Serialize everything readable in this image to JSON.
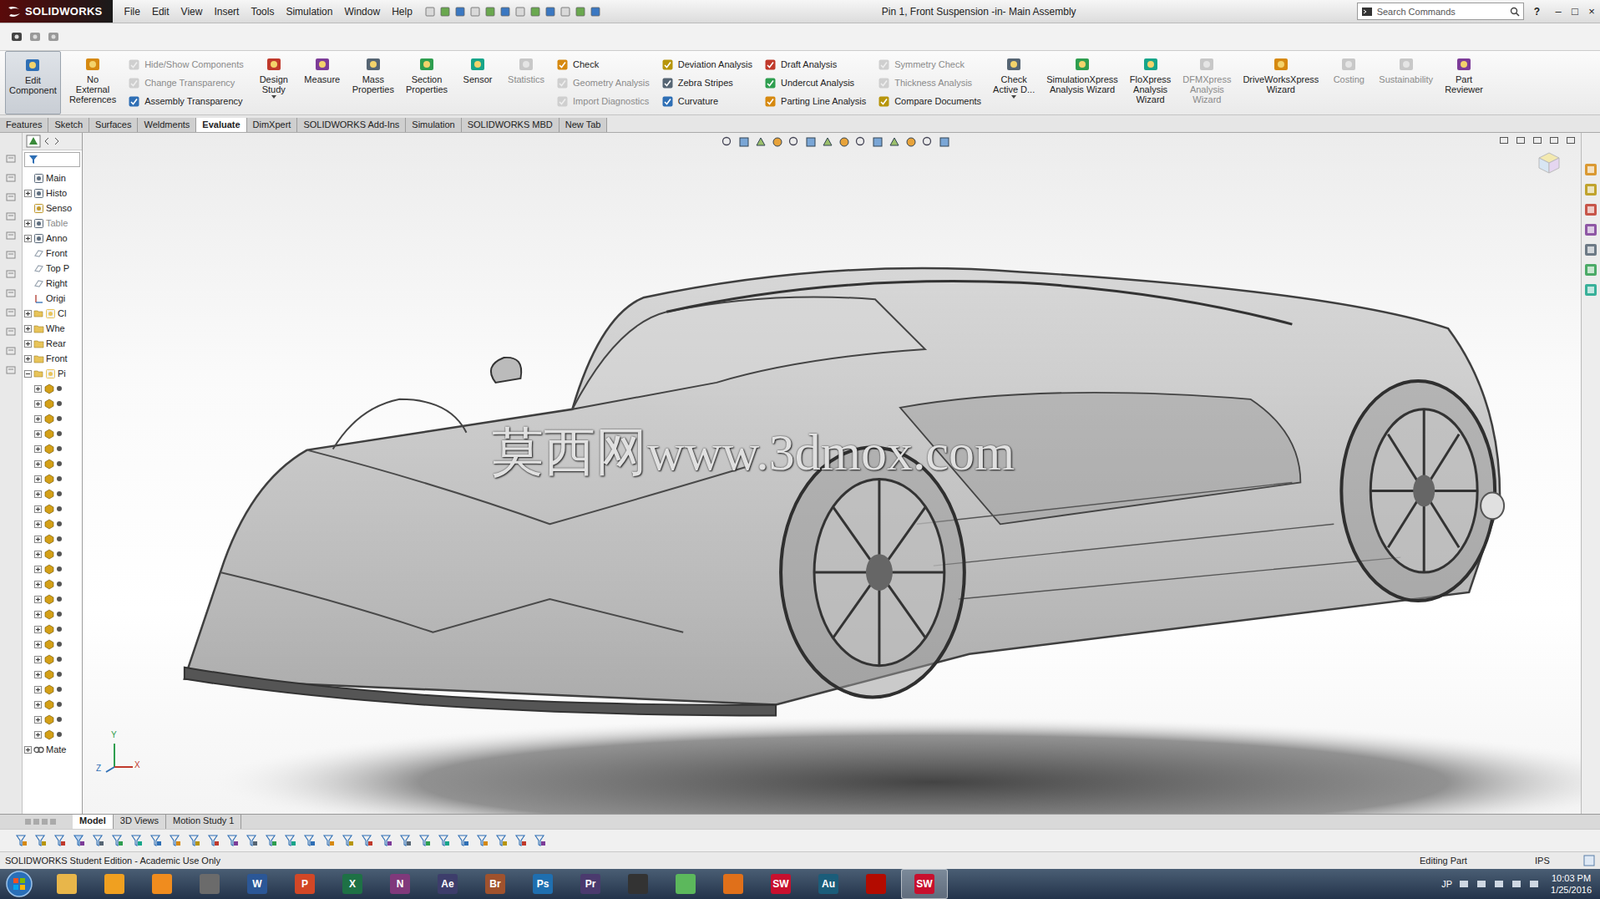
{
  "window": {
    "title": "Pin 1, Front Suspension -in- Main Assembly",
    "help": "?",
    "controls": [
      "–",
      "□",
      "×"
    ]
  },
  "logo": {
    "name": "SOLIDWORKS"
  },
  "menu": [
    "File",
    "Edit",
    "View",
    "Insert",
    "Tools",
    "Simulation",
    "Window",
    "Help"
  ],
  "search": {
    "placeholder": "Search Commands"
  },
  "ribbon": [
    {
      "kind": "large",
      "lines": [
        "Edit",
        "Component"
      ],
      "disabled": false,
      "selected": true,
      "dropdown": false
    },
    {
      "kind": "large",
      "lines": [
        "No",
        "External",
        "References"
      ],
      "disabled": false,
      "selected": false,
      "dropdown": false
    },
    {
      "kind": "stack",
      "items": [
        {
          "label": "Hide/Show Components",
          "disabled": true
        },
        {
          "label": "Change Transparency",
          "disabled": true
        },
        {
          "label": "Assembly Transparency",
          "disabled": false
        }
      ]
    },
    {
      "kind": "large",
      "lines": [
        "Design",
        "Study"
      ],
      "disabled": false,
      "selected": false,
      "dropdown": true
    },
    {
      "kind": "large",
      "lines": [
        "Measure"
      ],
      "disabled": false,
      "selected": false,
      "dropdown": false
    },
    {
      "kind": "large",
      "lines": [
        "Mass",
        "Properties"
      ],
      "disabled": false,
      "selected": false,
      "dropdown": false
    },
    {
      "kind": "large",
      "lines": [
        "Section",
        "Properties"
      ],
      "disabled": false,
      "selected": false,
      "dropdown": false
    },
    {
      "kind": "large",
      "lines": [
        "Sensor"
      ],
      "disabled": false,
      "selected": false,
      "dropdown": false
    },
    {
      "kind": "large",
      "lines": [
        "Statistics"
      ],
      "disabled": true,
      "selected": false,
      "dropdown": false
    },
    {
      "kind": "stack",
      "items": [
        {
          "label": "Check",
          "disabled": false
        },
        {
          "label": "Geometry Analysis",
          "disabled": true
        },
        {
          "label": "Import Diagnostics",
          "disabled": true
        }
      ]
    },
    {
      "kind": "stack",
      "items": [
        {
          "label": "Deviation Analysis",
          "disabled": false
        },
        {
          "label": "Zebra Stripes",
          "disabled": false
        },
        {
          "label": "Curvature",
          "disabled": false
        }
      ]
    },
    {
      "kind": "stack",
      "items": [
        {
          "label": "Draft Analysis",
          "disabled": false
        },
        {
          "label": "Undercut Analysis",
          "disabled": false
        },
        {
          "label": "Parting Line Analysis",
          "disabled": false
        }
      ]
    },
    {
      "kind": "stack",
      "items": [
        {
          "label": "Symmetry Check",
          "disabled": true
        },
        {
          "label": "Thickness Analysis",
          "disabled": true
        },
        {
          "label": "Compare Documents",
          "disabled": false
        }
      ]
    },
    {
      "kind": "large",
      "lines": [
        "Check",
        "Active D..."
      ],
      "disabled": false,
      "selected": false,
      "dropdown": true
    },
    {
      "kind": "large",
      "lines": [
        "SimulationXpress",
        "Analysis Wizard"
      ],
      "disabled": false,
      "selected": false,
      "dropdown": false
    },
    {
      "kind": "large",
      "lines": [
        "FloXpress",
        "Analysis",
        "Wizard"
      ],
      "disabled": false,
      "selected": false,
      "dropdown": false
    },
    {
      "kind": "large",
      "lines": [
        "DFMXpress",
        "Analysis",
        "Wizard"
      ],
      "disabled": true,
      "selected": false,
      "dropdown": false
    },
    {
      "kind": "large",
      "lines": [
        "DriveWorksXpress",
        "Wizard"
      ],
      "disabled": false,
      "selected": false,
      "dropdown": false
    },
    {
      "kind": "large",
      "lines": [
        "Costing"
      ],
      "disabled": true,
      "selected": false,
      "dropdown": false
    },
    {
      "kind": "large",
      "lines": [
        "Sustainability"
      ],
      "disabled": true,
      "selected": false,
      "dropdown": false
    },
    {
      "kind": "large",
      "lines": [
        "Part",
        "Reviewer"
      ],
      "disabled": false,
      "selected": false,
      "dropdown": false
    }
  ],
  "tabs": [
    {
      "label": "Features",
      "selected": false
    },
    {
      "label": "Sketch",
      "selected": false
    },
    {
      "label": "Surfaces",
      "selected": false
    },
    {
      "label": "Weldments",
      "selected": false
    },
    {
      "label": "Evaluate",
      "selected": true
    },
    {
      "label": "DimXpert",
      "selected": false
    },
    {
      "label": "SOLIDWORKS Add-Ins",
      "selected": false
    },
    {
      "label": "Simulation",
      "selected": false
    },
    {
      "label": "SOLIDWORKS MBD",
      "selected": false
    },
    {
      "label": "New Tab",
      "selected": false
    }
  ],
  "tree": [
    {
      "label": "Main",
      "kind": "assembly",
      "level": 0,
      "expandable": false,
      "expanded": true,
      "disabled": false
    },
    {
      "label": "Histo",
      "kind": "history",
      "level": 0,
      "expandable": true,
      "expanded": false,
      "disabled": false
    },
    {
      "label": "Senso",
      "kind": "sensor",
      "level": 0,
      "expandable": false,
      "expanded": false,
      "disabled": false
    },
    {
      "label": "Table",
      "kind": "table",
      "level": 0,
      "expandable": true,
      "expanded": false,
      "disabled": true
    },
    {
      "label": "Anno",
      "kind": "annotation",
      "level": 0,
      "expandable": true,
      "expanded": false,
      "disabled": false
    },
    {
      "label": "Front",
      "kind": "plane",
      "level": 0,
      "expandable": false,
      "expanded": false,
      "disabled": false
    },
    {
      "label": "Top P",
      "kind": "plane",
      "level": 0,
      "expandable": false,
      "expanded": false,
      "disabled": false
    },
    {
      "label": "Right",
      "kind": "plane",
      "level": 0,
      "expandable": false,
      "expanded": false,
      "disabled": false
    },
    {
      "label": "Origi",
      "kind": "origin",
      "level": 0,
      "expandable": false,
      "expanded": false,
      "disabled": false
    },
    {
      "label": "Cl",
      "kind": "folder-assembly",
      "level": 0,
      "expandable": true,
      "expanded": false,
      "disabled": false
    },
    {
      "label": "Whe",
      "kind": "folder",
      "level": 0,
      "expandable": true,
      "expanded": false,
      "disabled": false
    },
    {
      "label": "Rear",
      "kind": "folder",
      "level": 0,
      "expandable": true,
      "expanded": false,
      "disabled": false
    },
    {
      "label": "Front",
      "kind": "folder",
      "level": 0,
      "expandable": true,
      "expanded": false,
      "disabled": false
    },
    {
      "label": "Pi",
      "kind": "folder-assembly",
      "level": 0,
      "expandable": true,
      "expanded": true,
      "disabled": false
    },
    {
      "label": "",
      "kind": "part",
      "level": 1,
      "expandable": true,
      "expanded": false,
      "disabled": false
    },
    {
      "label": "",
      "kind": "part",
      "level": 1,
      "expandable": true,
      "expanded": false,
      "disabled": false
    },
    {
      "label": "",
      "kind": "part",
      "level": 1,
      "expandable": true,
      "expanded": false,
      "disabled": false
    },
    {
      "label": "",
      "kind": "part",
      "level": 1,
      "expandable": true,
      "expanded": false,
      "disabled": false
    },
    {
      "label": "",
      "kind": "part",
      "level": 1,
      "expandable": true,
      "expanded": false,
      "disabled": false
    },
    {
      "label": "",
      "kind": "part",
      "level": 1,
      "expandable": true,
      "expanded": false,
      "disabled": false
    },
    {
      "label": "",
      "kind": "part",
      "level": 1,
      "expandable": true,
      "expanded": false,
      "disabled": false
    },
    {
      "label": "",
      "kind": "part",
      "level": 1,
      "expandable": true,
      "expanded": false,
      "disabled": false
    },
    {
      "label": "",
      "kind": "part",
      "level": 1,
      "expandable": true,
      "expanded": false,
      "disabled": false
    },
    {
      "label": "",
      "kind": "part",
      "level": 1,
      "expandable": true,
      "expanded": false,
      "disabled": false
    },
    {
      "label": "",
      "kind": "part",
      "level": 1,
      "expandable": true,
      "expanded": false,
      "disabled": false
    },
    {
      "label": "",
      "kind": "part",
      "level": 1,
      "expandable": true,
      "expanded": false,
      "disabled": false
    },
    {
      "label": "",
      "kind": "part",
      "level": 1,
      "expandable": true,
      "expanded": false,
      "disabled": false
    },
    {
      "label": "",
      "kind": "part",
      "level": 1,
      "expandable": true,
      "expanded": false,
      "disabled": false
    },
    {
      "label": "",
      "kind": "part",
      "level": 1,
      "expandable": true,
      "expanded": false,
      "disabled": false
    },
    {
      "label": "",
      "kind": "part",
      "level": 1,
      "expandable": true,
      "expanded": false,
      "disabled": false
    },
    {
      "label": "",
      "kind": "part",
      "level": 1,
      "expandable": true,
      "expanded": false,
      "disabled": false
    },
    {
      "label": "",
      "kind": "part",
      "level": 1,
      "expandable": true,
      "expanded": false,
      "disabled": false
    },
    {
      "label": "",
      "kind": "part",
      "level": 1,
      "expandable": true,
      "expanded": false,
      "disabled": false
    },
    {
      "label": "",
      "kind": "part",
      "level": 1,
      "expandable": true,
      "expanded": false,
      "disabled": false
    },
    {
      "label": "",
      "kind": "part",
      "level": 1,
      "expandable": true,
      "expanded": false,
      "disabled": false
    },
    {
      "label": "",
      "kind": "part",
      "level": 1,
      "expandable": true,
      "expanded": false,
      "disabled": false
    },
    {
      "label": "",
      "kind": "part",
      "level": 1,
      "expandable": true,
      "expanded": false,
      "disabled": false
    },
    {
      "label": "",
      "kind": "part",
      "level": 1,
      "expandable": true,
      "expanded": false,
      "disabled": false
    },
    {
      "label": "Mate",
      "kind": "mates",
      "level": 0,
      "expandable": true,
      "expanded": false,
      "disabled": false
    }
  ],
  "viewport": {
    "watermark": "莫西网www.3dmox.com",
    "triad": {
      "x": "X",
      "y": "Y",
      "z": "Z"
    }
  },
  "bottomTabs": [
    {
      "label": "Model",
      "selected": true
    },
    {
      "label": "3D Views",
      "selected": false
    },
    {
      "label": "Motion Study 1",
      "selected": false
    }
  ],
  "status": {
    "left": "SOLIDWORKS Student Edition - Academic Use Only",
    "mode": "Editing Part",
    "units": "IPS"
  },
  "taskbar": {
    "apps": [
      {
        "label": "",
        "color": "#e8b64a",
        "selected": false
      },
      {
        "label": "",
        "color": "#f0a020",
        "selected": false
      },
      {
        "label": "",
        "color": "#f08c1e",
        "selected": false
      },
      {
        "label": "",
        "color": "#6b6b6b",
        "selected": false
      },
      {
        "label": "W",
        "color": "#2b5797",
        "selected": false
      },
      {
        "label": "P",
        "color": "#d24726",
        "selected": false
      },
      {
        "label": "X",
        "color": "#1e7145",
        "selected": false
      },
      {
        "label": "N",
        "color": "#80397b",
        "selected": false
      },
      {
        "label": "Ae",
        "color": "#3d3d6b",
        "selected": false
      },
      {
        "label": "Br",
        "color": "#a0522d",
        "selected": false
      },
      {
        "label": "Ps",
        "color": "#1f6fb0",
        "selected": false
      },
      {
        "label": "Pr",
        "color": "#4b3a6e",
        "selected": false
      },
      {
        "label": "",
        "color": "#333333",
        "selected": false
      },
      {
        "label": "",
        "color": "#5cb85c",
        "selected": false
      },
      {
        "label": "",
        "color": "#e0701a",
        "selected": false
      },
      {
        "label": "SW",
        "color": "#c8102e",
        "selected": false
      },
      {
        "label": "Au",
        "color": "#1b5d7a",
        "selected": false
      },
      {
        "label": "",
        "color": "#b30b00",
        "selected": false
      },
      {
        "label": "SW",
        "color": "#c8102e",
        "selected": true
      }
    ],
    "lang": "JP",
    "time": "10:03 PM",
    "date": "1/25/2016"
  }
}
